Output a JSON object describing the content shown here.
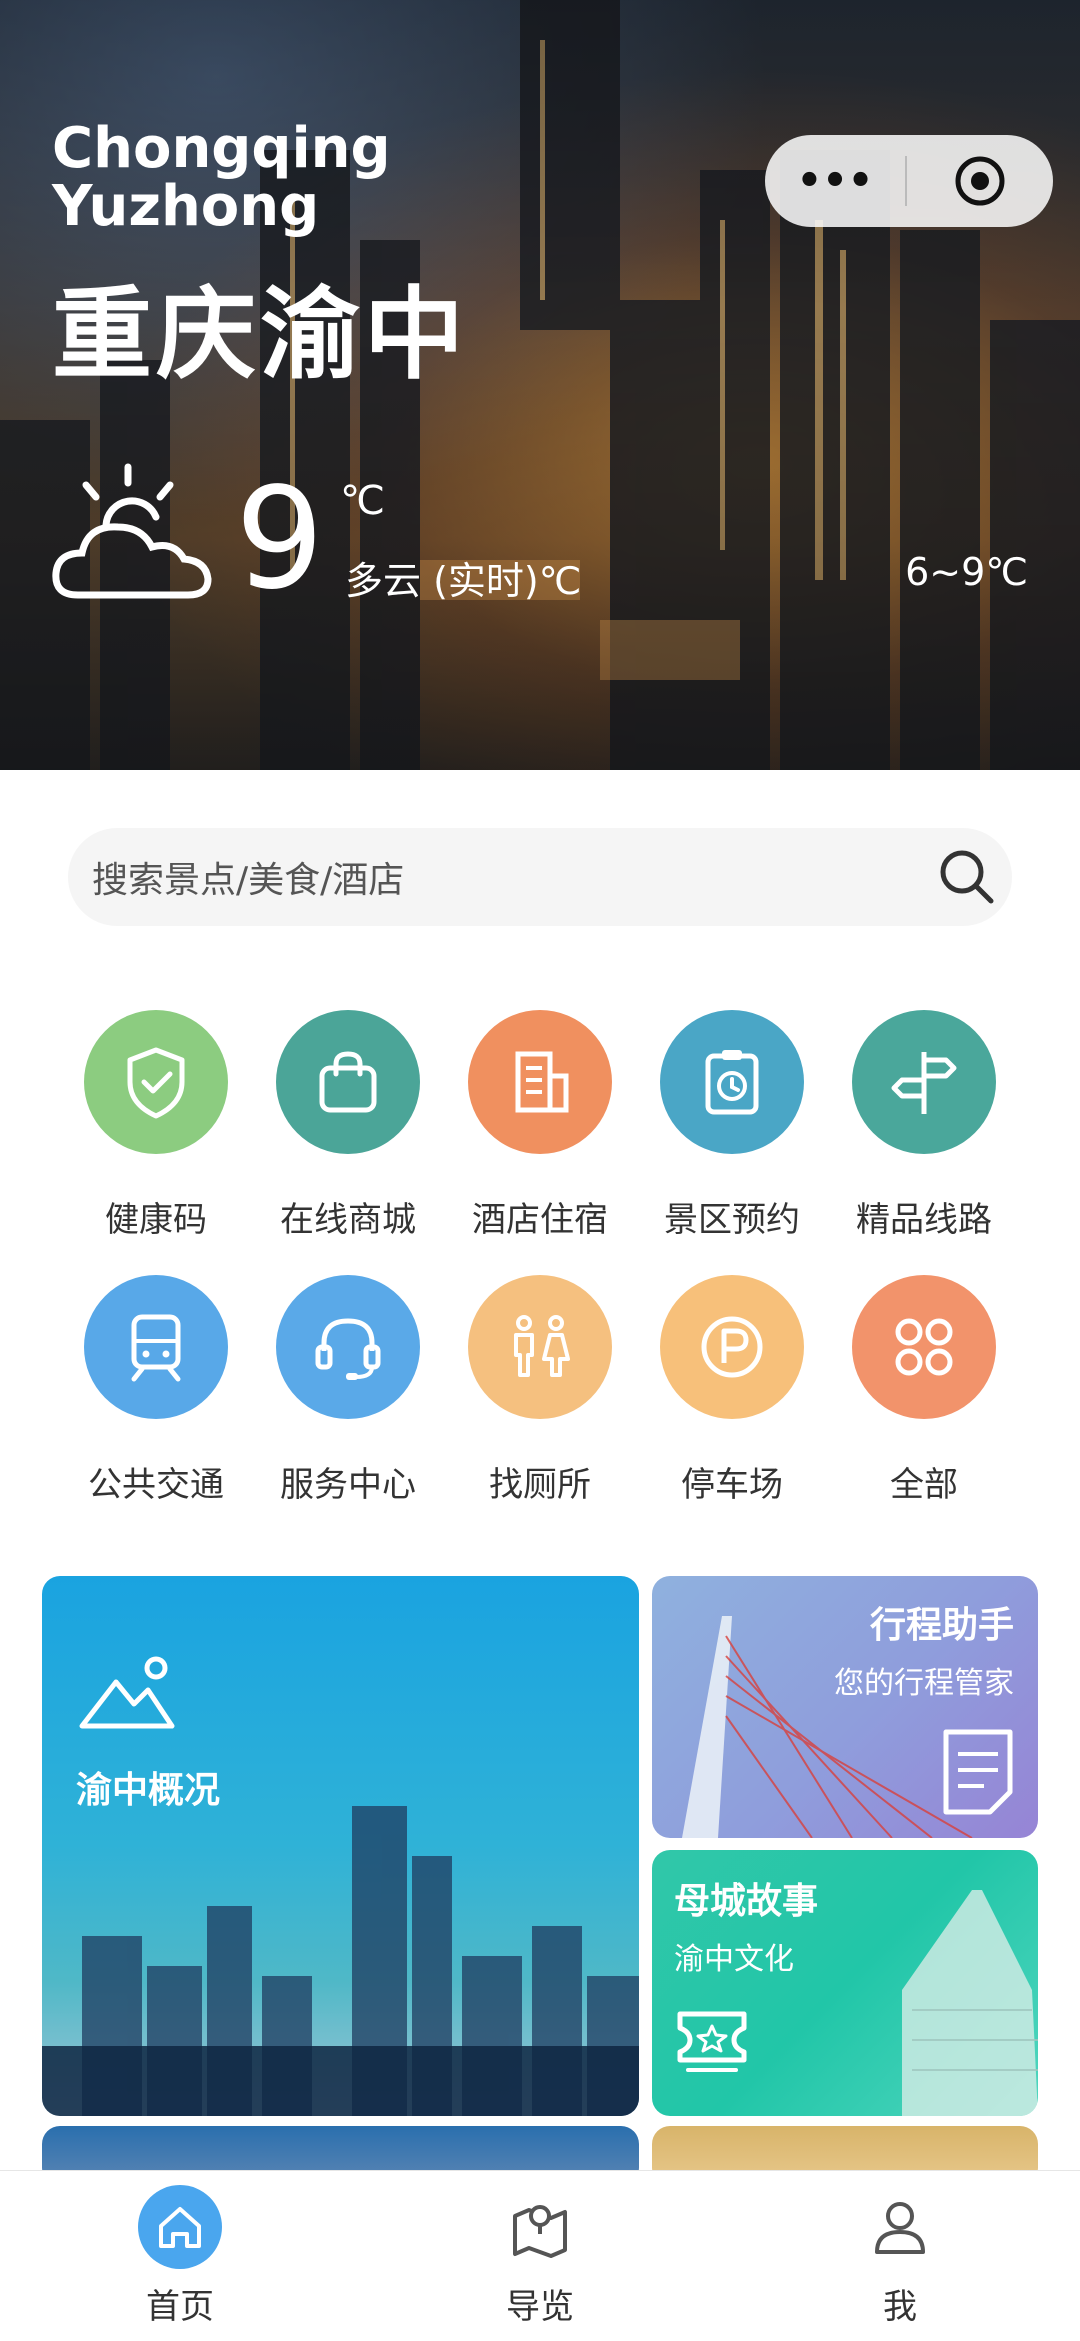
{
  "hero": {
    "title_en_line1": "Chongqing",
    "title_en_line2": "Yuzhong",
    "title_zh": "重庆渝中",
    "capsule_more": "•••",
    "weather": {
      "icon": "cloudy-sun-icon",
      "temperature": "9",
      "unit": "℃",
      "description": "多云 (实时)℃",
      "range": "6~9℃"
    }
  },
  "search": {
    "placeholder": "搜索景点/美食/酒店"
  },
  "grid": {
    "items": [
      {
        "label": "健康码",
        "icon": "shield-check-icon",
        "color": "#8ccc80"
      },
      {
        "label": "在线商城",
        "icon": "shopping-bag-icon",
        "color": "#4ba598"
      },
      {
        "label": "酒店住宿",
        "icon": "building-icon",
        "color": "#f0905f"
      },
      {
        "label": "景区预约",
        "icon": "clipboard-clock-icon",
        "color": "#4aa6c6"
      },
      {
        "label": "精品线路",
        "icon": "signpost-icon",
        "color": "#4aa79b"
      },
      {
        "label": "公共交通",
        "icon": "train-icon",
        "color": "#58a8e8"
      },
      {
        "label": "服务中心",
        "icon": "headset-icon",
        "color": "#5aa9e8"
      },
      {
        "label": "找厕所",
        "icon": "restroom-icon",
        "color": "#f5c07f"
      },
      {
        "label": "停车场",
        "icon": "parking-icon",
        "color": "#f7c07a"
      },
      {
        "label": "全部",
        "icon": "grid-all-icon",
        "color": "#f2936b"
      }
    ]
  },
  "cards": {
    "overview": {
      "title": "渝中概况",
      "icon": "mountain-sun-icon"
    },
    "itinerary": {
      "title": "行程助手",
      "subtitle": "您的行程管家",
      "icon": "document-icon"
    },
    "story": {
      "title": "母城故事",
      "subtitle": "渝中文化",
      "icon": "ticket-star-icon"
    }
  },
  "tabbar": {
    "items": [
      {
        "label": "首页",
        "icon": "home-icon",
        "active": true
      },
      {
        "label": "导览",
        "icon": "map-pin-icon",
        "active": false
      },
      {
        "label": "我",
        "icon": "user-icon",
        "active": false
      }
    ]
  },
  "colors": {
    "accent": "#4aa6ee",
    "text": "#333333"
  }
}
